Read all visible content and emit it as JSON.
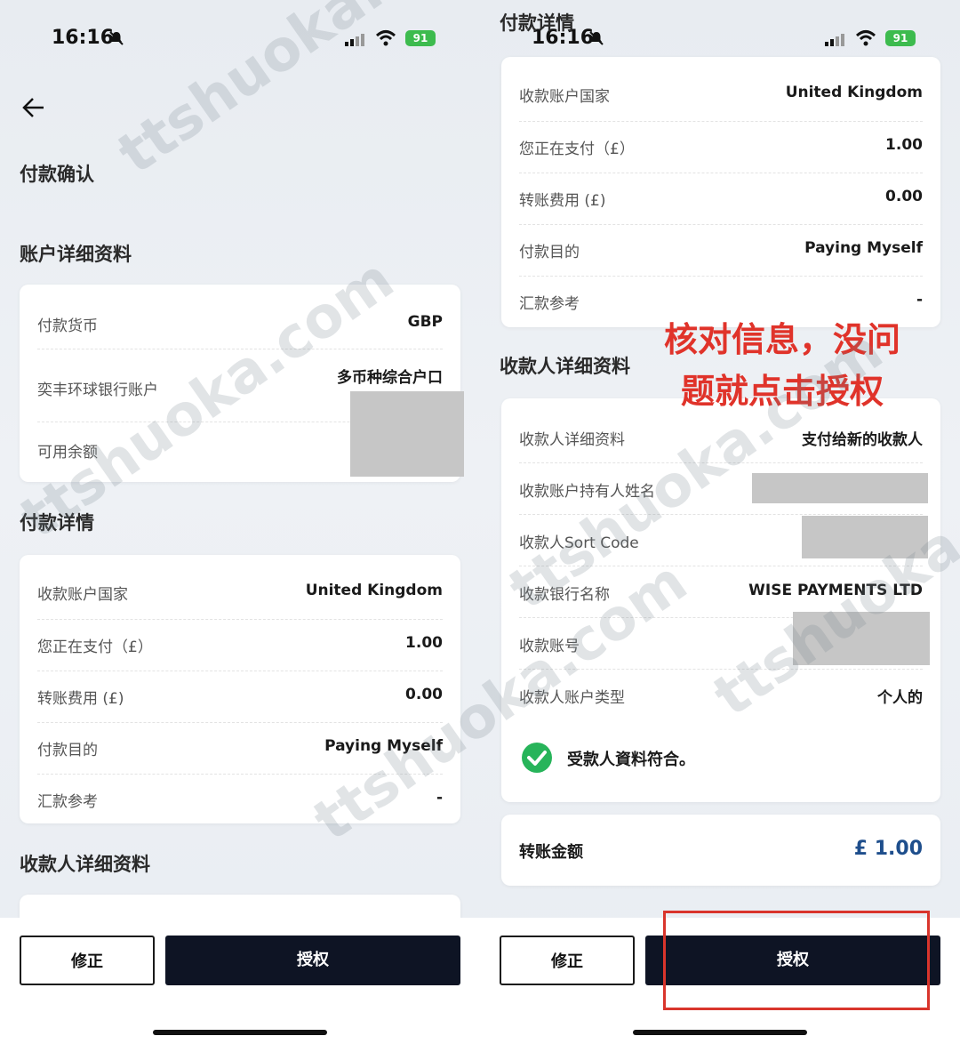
{
  "status_bar": {
    "time": "16:16",
    "battery": "91"
  },
  "left": {
    "page_title": "付款确认",
    "account_section_title": "账户详细资料",
    "account_rows": [
      {
        "label": "付款货币",
        "value": "GBP"
      },
      {
        "label": "奕丰环球银行账户",
        "value": "多币种综合户口"
      },
      {
        "label": "可用余额",
        "value": ""
      }
    ],
    "payment_section_title": "付款详情",
    "payment_rows": [
      {
        "label": "收款账户国家",
        "value": "United Kingdom"
      },
      {
        "label": "您正在支付（£）",
        "value": "1.00"
      },
      {
        "label": "转账费用 (£)",
        "value": "0.00"
      },
      {
        "label": "付款目的",
        "value": "Paying Myself"
      },
      {
        "label": "汇款参考",
        "value": "-"
      }
    ],
    "payee_section_title": "收款人详细资料"
  },
  "right": {
    "top_title": "付款详情",
    "payment_rows": [
      {
        "label": "收款账户国家",
        "value": "United Kingdom"
      },
      {
        "label": "您正在支付（£）",
        "value": "1.00"
      },
      {
        "label": "转账费用 (£)",
        "value": "0.00"
      },
      {
        "label": "付款目的",
        "value": "Paying Myself"
      },
      {
        "label": "汇款参考",
        "value": "-"
      }
    ],
    "payee_section_title": "收款人详细资料",
    "payee_rows": [
      {
        "label": "收款人详细资料",
        "value": "支付给新的收款人"
      },
      {
        "label": "收款账户持有人姓名",
        "value": ""
      },
      {
        "label": "收款人Sort Code",
        "value": ""
      },
      {
        "label": "收款银行名称",
        "value": "WISE PAYMENTS LTD"
      },
      {
        "label": "收款账号",
        "value": ""
      },
      {
        "label": "收款人账户类型",
        "value": "个人的"
      }
    ],
    "payee_verified": "受款人資料符合。",
    "amount_label": "转账金额",
    "amount_value": "£ 1.00",
    "annotation_line1": "核对信息，没问",
    "annotation_line2": "题就点击授权"
  },
  "buttons": {
    "amend": "修正",
    "authorize": "授权"
  },
  "watermark": "ttshuoka.com",
  "colors": {
    "primary_dark": "#0e1424",
    "amount_blue": "#1e4e8c",
    "verified_green": "#27b45a",
    "annotation_red": "#e0332a"
  }
}
